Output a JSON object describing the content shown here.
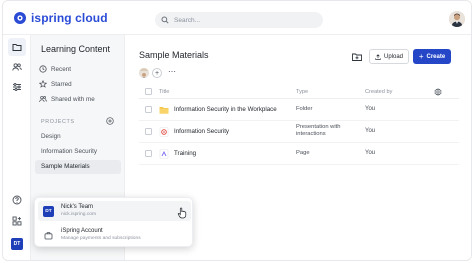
{
  "app": {
    "logo_text": "ispring cloud"
  },
  "search": {
    "placeholder": "Search..."
  },
  "sidebar": {
    "title": "Learning Content",
    "items": [
      {
        "label": "Recent",
        "icon": "clock-icon"
      },
      {
        "label": "Starred",
        "icon": "star-icon"
      },
      {
        "label": "Shared with me",
        "icon": "users-icon"
      }
    ],
    "projects_label": "PROJECTS",
    "projects": [
      {
        "label": "Design"
      },
      {
        "label": "Information Security"
      },
      {
        "label": "Sample Materials",
        "selected": true
      }
    ]
  },
  "main": {
    "title": "Sample Materials",
    "upload_label": "Upload",
    "create_label": "Create",
    "columns": {
      "title": "Title",
      "type": "Type",
      "created_by": "Created by"
    },
    "rows": [
      {
        "title": "Information Security in the Workplace",
        "type": "Folder",
        "owner": "You",
        "icon": "folder-icon"
      },
      {
        "title": "Information Security",
        "type": "Presentation with interactions",
        "owner": "You",
        "icon": "presentation-icon"
      },
      {
        "title": "Training",
        "type": "Page",
        "owner": "You",
        "icon": "page-icon"
      }
    ]
  },
  "rail": {
    "badge": "DT"
  },
  "popup": {
    "team": {
      "badge": "DT",
      "title": "Nick's Team",
      "subtitle": "nick.ispring.com"
    },
    "account": {
      "title": "iSpring Account",
      "subtitle": "Manage payments and subscriptions"
    }
  },
  "colors": {
    "accent": "#2446c7",
    "badge": "#1f3fb8",
    "folder": "#f5c54a",
    "presentation": "#e0463b",
    "page": "#7b6cf0"
  }
}
